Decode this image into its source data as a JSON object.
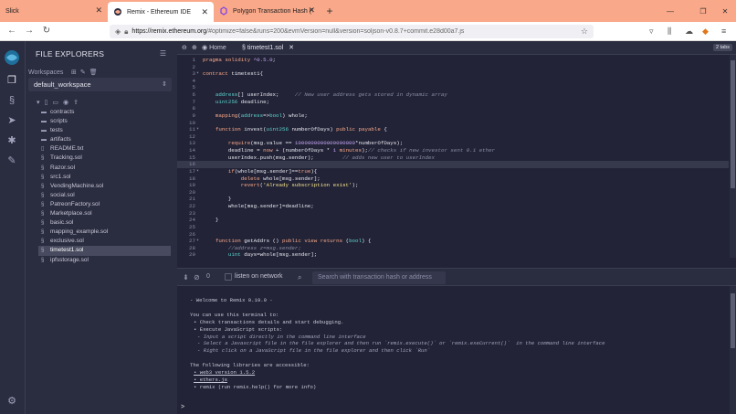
{
  "browser": {
    "tabs": [
      {
        "title": "Slick",
        "active": false
      },
      {
        "title": "Remix - Ethereum IDE",
        "active": true
      },
      {
        "title": "Polygon Transaction Hash (Txha",
        "active": false
      }
    ],
    "new_tab": "+",
    "url_host": "https://remix.ethereum.org",
    "url_rest": "/#optimize=false&runs=200&evmVersion=null&version=soljson-v0.8.7+commit.e28d00a7.js"
  },
  "sidebar": {
    "title": "FILE EXPLORERS",
    "workspaces_label": "Workspaces",
    "workspace_selected": "default_workspace",
    "files": [
      {
        "name": "contracts",
        "type": "folder"
      },
      {
        "name": "scripts",
        "type": "folder"
      },
      {
        "name": "tests",
        "type": "folder"
      },
      {
        "name": "artifacts",
        "type": "folder"
      },
      {
        "name": "README.txt",
        "type": "file"
      },
      {
        "name": "Tracking.sol",
        "type": "sol"
      },
      {
        "name": "Razor.sol",
        "type": "sol"
      },
      {
        "name": "src1.sol",
        "type": "sol"
      },
      {
        "name": "VendingMachine.sol",
        "type": "sol"
      },
      {
        "name": "social.sol",
        "type": "sol"
      },
      {
        "name": "PatreonFactory.sol",
        "type": "sol"
      },
      {
        "name": "Marketplace.sol",
        "type": "sol"
      },
      {
        "name": "basic.sol",
        "type": "sol"
      },
      {
        "name": "mapping_example.sol",
        "type": "sol"
      },
      {
        "name": "exclusive.sol",
        "type": "sol"
      },
      {
        "name": "timetest1.sol",
        "type": "sol",
        "selected": true
      },
      {
        "name": "ipfsstorage.sol",
        "type": "sol"
      }
    ]
  },
  "editor": {
    "home_tab": "Home",
    "file_tab": "timetest1.sol",
    "tabs_badge": "2 tabs",
    "highlight_line": 16,
    "lines": [
      {
        "n": "1",
        "fold": "",
        "html": "<span class='kw'>pragma solidity</span> <span class='nm'>^0.5.0</span>;"
      },
      {
        "n": "2",
        "fold": "",
        "html": ""
      },
      {
        "n": "3",
        "fold": "▾",
        "html": "<span class='kw'>contract</span> timetest1{"
      },
      {
        "n": "4",
        "fold": "",
        "html": ""
      },
      {
        "n": "5",
        "fold": "",
        "html": ""
      },
      {
        "n": "6",
        "fold": "",
        "html": "    <span class='ty'>address</span>[] userIndex;     <span class='cm'>// New user address gets stored in dynamic array</span>"
      },
      {
        "n": "7",
        "fold": "",
        "html": "    <span class='ty'>uint256</span> deadline;"
      },
      {
        "n": "8",
        "fold": "",
        "html": ""
      },
      {
        "n": "9",
        "fold": "",
        "html": "    <span class='kw'>mapping</span>(<span class='ty'>address</span>=&gt;<span class='ty'>bool</span>) whole;"
      },
      {
        "n": "10",
        "fold": "",
        "html": ""
      },
      {
        "n": "11",
        "fold": "▾",
        "html": "    <span class='kw'>function</span> invest(<span class='ty'>uint256</span> numberOfDays) <span class='kw'>public payable</span> {"
      },
      {
        "n": "12",
        "fold": "",
        "html": ""
      },
      {
        "n": "13",
        "fold": "",
        "html": "        <span class='kw'>require</span>(msg.value == <span class='nm'>1000000000000000000</span>*numberOfDays);"
      },
      {
        "n": "14",
        "fold": "",
        "html": "        deadline = <span class='kw'>now</span> + (numberOfDays * <span class='nm'>1</span> <span class='kw'>minutes</span>);<span class='cm'>// checks if new investor sent 0.1 ether</span>"
      },
      {
        "n": "15",
        "fold": "",
        "html": "        userIndex.push(msg.sender);         <span class='cm'>// adds new user to userIndex</span>"
      },
      {
        "n": "16",
        "fold": "",
        "html": ""
      },
      {
        "n": "17",
        "fold": "▾",
        "html": "        <span class='kw'>if</span>(whole[msg.sender]==<span class='kw'>true</span>){"
      },
      {
        "n": "18",
        "fold": "",
        "html": "            <span class='kw'>delete</span> whole[msg.sender];"
      },
      {
        "n": "19",
        "fold": "",
        "html": "            <span class='kw'>revert</span>(<span class='st'>'Already subscription exist'</span>);"
      },
      {
        "n": "20",
        "fold": "",
        "html": ""
      },
      {
        "n": "21",
        "fold": "",
        "html": "        }"
      },
      {
        "n": "22",
        "fold": "",
        "html": "        whole[msg.sender]=deadline;"
      },
      {
        "n": "23",
        "fold": "",
        "html": ""
      },
      {
        "n": "24",
        "fold": "",
        "html": "    }"
      },
      {
        "n": "25",
        "fold": "",
        "html": ""
      },
      {
        "n": "26",
        "fold": "",
        "html": ""
      },
      {
        "n": "27",
        "fold": "▾",
        "html": "    <span class='kw'>function</span> getAddrs () <span class='kw'>public view returns</span> (<span class='ty'>bool</span>) {"
      },
      {
        "n": "28",
        "fold": "",
        "html": "        <span class='cm'>//address z=msg.sender;</span>"
      },
      {
        "n": "29",
        "fold": "",
        "html": "        <span class='ty'>uint</span> days=whole[msg.sender];"
      }
    ]
  },
  "terminal": {
    "count": "0",
    "listen_label": "listen on network",
    "search_placeholder": "Search with transaction hash or address",
    "prompt": ">",
    "lines": [
      {
        "t": "- Welcome to Remix 0.19.0 -",
        "indent": 0
      },
      {
        "t": "",
        "indent": 0
      },
      {
        "t": "You can use this terminal to:",
        "indent": 0
      },
      {
        "t": "• Check transactions details and start debugging.",
        "indent": 1
      },
      {
        "t": "• Execute JavaScript scripts:",
        "indent": 1
      },
      {
        "t": "- Input a script directly in the command line interface",
        "indent": 2,
        "italic": true
      },
      {
        "t": "- Select a Javascript file in the file explorer and then run `remix.execute()` or `remix.exeCurrent()`  in the command line interface",
        "indent": 2,
        "italic": true
      },
      {
        "t": "- Right click on a JavaScript file in the file explorer and then click `Run`",
        "indent": 2,
        "italic": true
      },
      {
        "t": "",
        "indent": 0
      },
      {
        "t": "The following libraries are accessible:",
        "indent": 0
      },
      {
        "t": "• web3 version 1.5.2",
        "indent": 1,
        "link": true
      },
      {
        "t": "• ethers.js",
        "indent": 1,
        "link": true
      },
      {
        "t": "• remix (run remix.help() for more info)",
        "indent": 1
      }
    ]
  },
  "colors": {
    "accent": "#f9a889",
    "panel": "#2a2c3f",
    "editor_bg": "#222336"
  }
}
